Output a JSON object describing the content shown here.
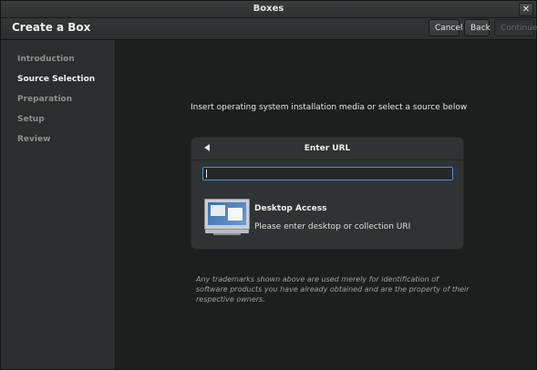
{
  "window": {
    "title": "Boxes",
    "close_glyph": "✕"
  },
  "header": {
    "title": "Create a Box",
    "cancel_label": "Cancel",
    "back_label": "Back",
    "continue_label": "Continue"
  },
  "sidebar": {
    "items": [
      {
        "label": "Introduction",
        "active": false
      },
      {
        "label": "Source Selection",
        "active": true
      },
      {
        "label": "Preparation",
        "active": false
      },
      {
        "label": "Setup",
        "active": false
      },
      {
        "label": "Review",
        "active": false
      }
    ]
  },
  "main": {
    "instruction": "Insert operating system installation media or select a source below",
    "panel": {
      "title": "Enter URL",
      "url_value": "",
      "item": {
        "title": "Desktop Access",
        "subtitle": "Please enter desktop or collection URI",
        "icon": "desktop-monitor-icon"
      }
    },
    "disclaimer": "Any trademarks shown above are used merely for identification of software products you have already obtained and are the property of their respective owners."
  },
  "colors": {
    "accent": "#4a90d9",
    "sidebar_bg": "#2b2e2e",
    "main_bg": "#1d1f1f"
  }
}
